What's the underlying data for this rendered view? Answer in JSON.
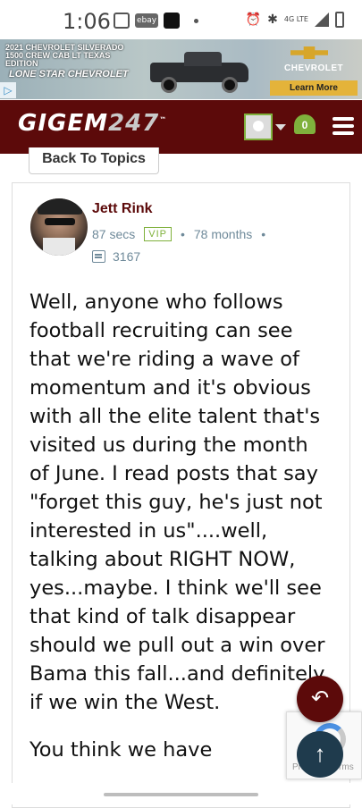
{
  "status_bar": {
    "time": "1:06",
    "ebay_label": "ebay",
    "network": "4G LTE"
  },
  "ad": {
    "headline": "2021 CHEVROLET SILVERADO 1500 CREW CAB LT TEXAS EDITION",
    "dealer": "LONE STAR CHEVROLET",
    "brand": "CHEVROLET",
    "cta": "Learn More"
  },
  "navbar": {
    "logo_text": "GIGEM",
    "logo_num": "247",
    "logo_tm": "™",
    "notification_count": "0"
  },
  "back_button": "Back To Topics",
  "post": {
    "username": "Jett Rink",
    "time_ago": "87 secs",
    "badge": "VIP",
    "member_for": "78 months",
    "post_count": "3167",
    "paragraphs": [
      "Well, anyone who follows football recruiting can see that we're riding a wave of momentum and it's obvious with all the elite talent that's visited us during the month of June. I read posts that say \"forget this guy, he's just not interested in us\"....well, talking about RIGHT NOW, yes...maybe. I think we'll see that kind of talk disappear should we pull out a win over Bama this fall...and definitely if we win the West.",
      "You think we have"
    ]
  },
  "recaptcha": {
    "text": "Privacy - Terms"
  },
  "fab": {
    "reply_icon": "reply-arrow-icon",
    "top_icon": "arrow-up-icon"
  },
  "colors": {
    "maroon": "#5c0a0a",
    "green": "#7fb13c",
    "meta": "#6f8a9a",
    "fab_dark": "#1f3b4d"
  }
}
